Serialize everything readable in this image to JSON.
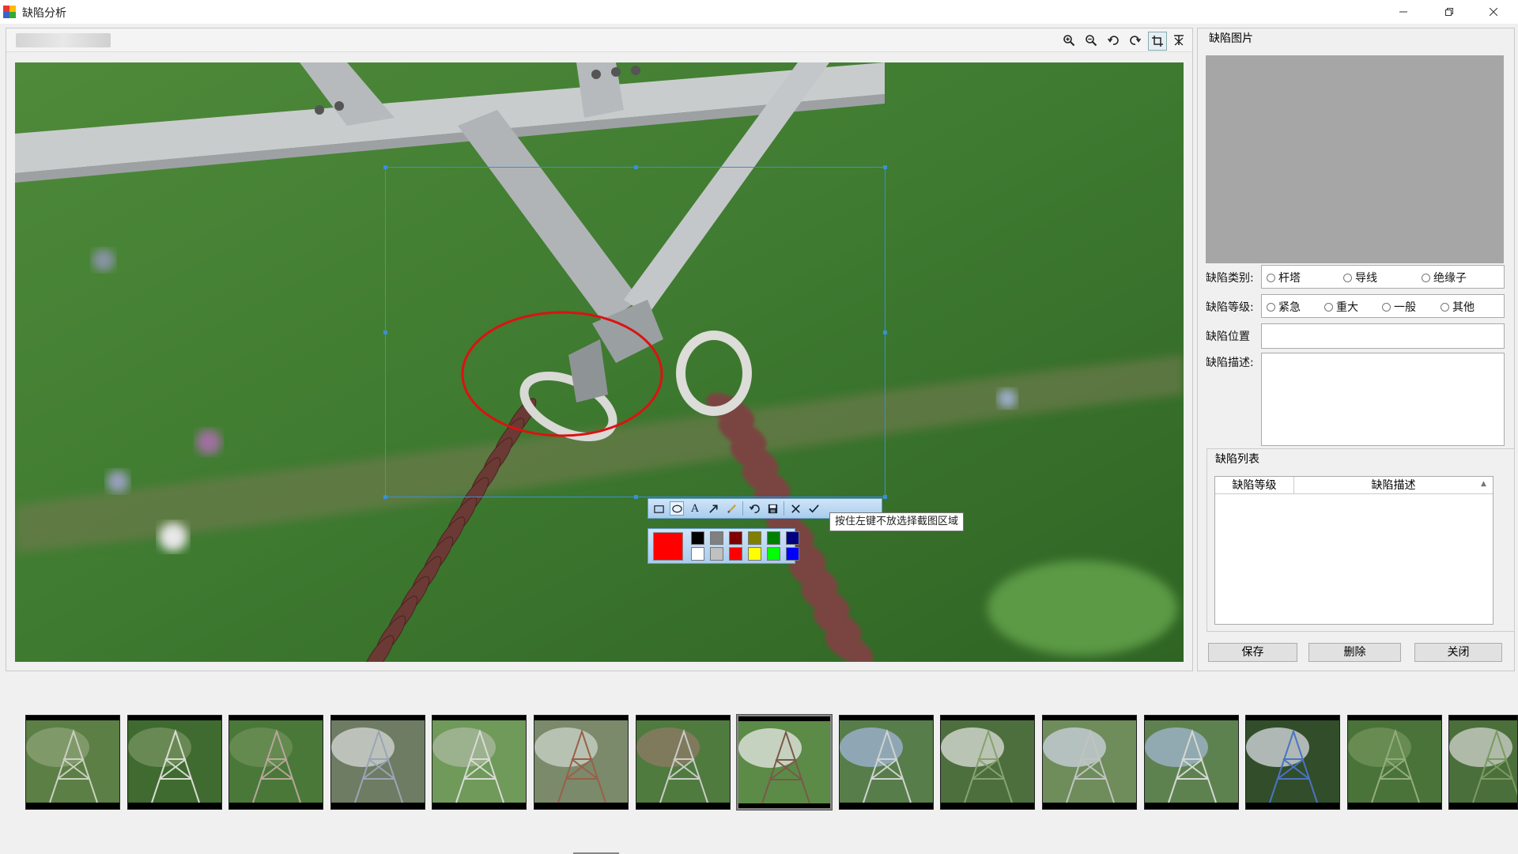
{
  "window": {
    "title": "缺陷分析",
    "icon": "app-logo-icon",
    "controls": [
      "minimize-icon",
      "restore-icon",
      "close-icon"
    ]
  },
  "viewer": {
    "toolbar_icons": [
      "zoom-in-icon",
      "zoom-out-icon",
      "rotate-left-icon",
      "rotate-right-icon",
      "crop-icon",
      "clear-icon"
    ],
    "active_tool": "crop-icon",
    "photo_subject": "transmission tower insulator"
  },
  "annotation": {
    "tools": [
      "rectangle-icon",
      "ellipse-icon",
      "text-icon",
      "arrow-icon",
      "brush-icon",
      "undo-icon",
      "save-icon",
      "cancel-icon",
      "confirm-icon"
    ],
    "text_tool_label": "A",
    "current_color": "#ff0000",
    "palette_row1": [
      "#000000",
      "#808080",
      "#800000",
      "#808000",
      "#008000",
      "#000080"
    ],
    "palette_row2": [
      "#ffffff",
      "#c0c0c0",
      "#ff0000",
      "#ffff00",
      "#00ff00",
      "#0000ff"
    ],
    "tooltip": "按住左键不放选择截图区域"
  },
  "right_panel": {
    "image_title": "缺陷图片",
    "category_label": "缺陷类别:",
    "category_options": [
      "杆塔",
      "导线",
      "绝缘子"
    ],
    "level_label": "缺陷等级:",
    "level_options": [
      "紧急",
      "重大",
      "一般",
      "其他"
    ],
    "position_label": "缺陷位置",
    "position_value": "",
    "description_label": "缺陷描述:",
    "description_value": "",
    "list_title": "缺陷列表",
    "list_columns": [
      "缺陷等级",
      "缺陷描述"
    ],
    "list_rows": [],
    "buttons": {
      "save": "保存",
      "delete": "删除",
      "close": "关闭"
    }
  },
  "thumbnails": {
    "count": 15,
    "selected_index": 7
  },
  "colors": {
    "selection": "#3a8fd6",
    "annotation_circle": "#dd1111",
    "panel_bg": "#f0f0f0",
    "defect_image_bg": "#a6a6a6"
  }
}
